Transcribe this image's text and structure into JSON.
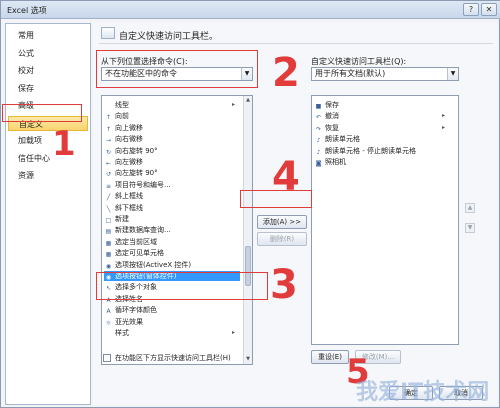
{
  "window": {
    "title": "Excel 选项",
    "help": "?",
    "close": "✕"
  },
  "nav": {
    "items": [
      {
        "label": "常用",
        "selected": false
      },
      {
        "label": "公式",
        "selected": false
      },
      {
        "label": "校对",
        "selected": false
      },
      {
        "label": "保存",
        "selected": false
      },
      {
        "label": "高级",
        "selected": false
      },
      {
        "label": "自定义",
        "selected": true
      },
      {
        "label": "加载项",
        "selected": false
      },
      {
        "label": "信任中心",
        "selected": false
      },
      {
        "label": "资源",
        "selected": false
      }
    ]
  },
  "main": {
    "heading": "自定义快速访问工具栏。",
    "choose_label": "从下列位置选择命令(C):",
    "choose_value": "不在功能区中的命令",
    "customize_label": "自定义快速访问工具栏(Q):",
    "customize_value": "用于所有文档(默认)",
    "left_list": [
      {
        "icon": "line-icon",
        "glyph": "",
        "label": "线型",
        "sub": "▸"
      },
      {
        "icon": "arrow-up-icon",
        "glyph": "↑",
        "label": "向前",
        "sub": ""
      },
      {
        "icon": "arrow-up-icon",
        "glyph": "↑",
        "label": "向上微移",
        "sub": ""
      },
      {
        "icon": "arrow-right-icon",
        "glyph": "→",
        "label": "向右微移",
        "sub": ""
      },
      {
        "icon": "rotate-right-icon",
        "glyph": "↻",
        "label": "向右旋转 90°",
        "sub": ""
      },
      {
        "icon": "arrow-left-icon",
        "glyph": "←",
        "label": "向左微移",
        "sub": ""
      },
      {
        "icon": "rotate-left-icon",
        "glyph": "↺",
        "label": "向左旋转 90°",
        "sub": ""
      },
      {
        "icon": "list-icon",
        "glyph": "≡",
        "label": "项目符号和编号...",
        "sub": ""
      },
      {
        "icon": "diag-up-icon",
        "glyph": "╱",
        "label": "斜上框线",
        "sub": ""
      },
      {
        "icon": "diag-down-icon",
        "glyph": "╲",
        "label": "斜下框线",
        "sub": ""
      },
      {
        "icon": "new-icon",
        "glyph": "□",
        "label": "新建",
        "sub": ""
      },
      {
        "icon": "db-query-icon",
        "glyph": "▤",
        "label": "新建数据库查询...",
        "sub": ""
      },
      {
        "icon": "select-region-icon",
        "glyph": "▦",
        "label": "选定当前区域",
        "sub": ""
      },
      {
        "icon": "select-visible-icon",
        "glyph": "▦",
        "label": "选定可见单元格",
        "sub": ""
      },
      {
        "icon": "option-button-icon",
        "glyph": "◉",
        "label": "选项按钮(ActiveX 控件)",
        "sub": ""
      },
      {
        "icon": "option-button-icon",
        "glyph": "◉",
        "label": "选项按钮(窗体控件)",
        "sub": "",
        "selected": true
      },
      {
        "icon": "select-objects-icon",
        "glyph": "↖",
        "label": "选择多个对象",
        "sub": ""
      },
      {
        "icon": "select-name-icon",
        "glyph": "A",
        "label": "选择姓名",
        "sub": ""
      },
      {
        "icon": "font-color-icon",
        "glyph": "A",
        "label": "循环字体颜色",
        "sub": ""
      },
      {
        "icon": "glow-icon",
        "glyph": "☼",
        "label": "亚光效果",
        "sub": ""
      },
      {
        "icon": "style-icon",
        "glyph": "",
        "label": "样式",
        "sub": "▸"
      }
    ],
    "right_list": [
      {
        "icon": "save-icon",
        "glyph": "■",
        "label": "保存"
      },
      {
        "icon": "undo-icon",
        "glyph": "↶",
        "label": "撤消",
        "sub": "▸"
      },
      {
        "icon": "redo-icon",
        "glyph": "↷",
        "label": "恢复",
        "sub": "▸"
      },
      {
        "icon": "speak-cells-icon",
        "glyph": "♪",
        "label": "朗读单元格"
      },
      {
        "icon": "stop-speak-icon",
        "glyph": "♪",
        "label": "朗读单元格 - 停止朗读单元格"
      },
      {
        "icon": "camera-icon",
        "glyph": "◙",
        "label": "照相机"
      }
    ],
    "add_button": "添加(A) >>",
    "remove_button": "删除(R)",
    "reset_button": "重设(E)",
    "modify_button": "修改(M)...",
    "below_ribbon_label": "在功能区下方显示快速访问工具栏(H)",
    "ok_button": "确定",
    "cancel_button": "取消"
  },
  "annotations": [
    "1",
    "2",
    "3",
    "4",
    "5"
  ],
  "watermark": "我爱IT技术网"
}
